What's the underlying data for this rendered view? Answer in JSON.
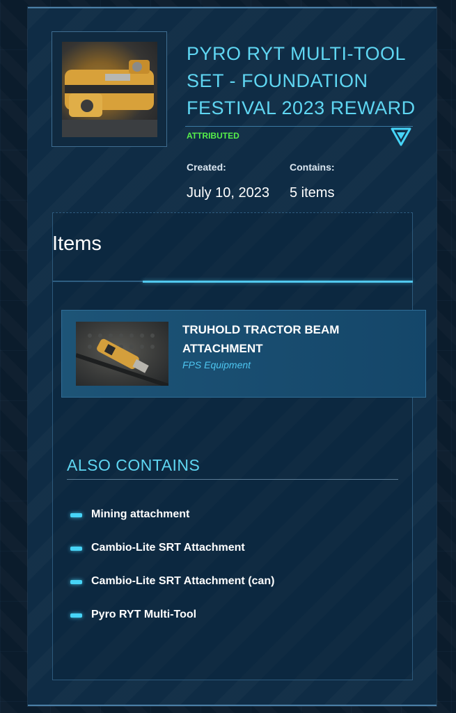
{
  "bundle": {
    "title": "PYRO RYT MULTI-TOOL SET - FOUNDATION FESTIVAL 2023 REWARD",
    "status": "ATTRIBUTED",
    "expand_icon": "triangle-down-icon",
    "thumbnail_icon": "multi-tool-image",
    "created_label": "Created:",
    "created_value": "July 10, 2023",
    "contains_label": "Contains:",
    "contains_value": "5 items"
  },
  "items_section": {
    "heading": "Items",
    "items": [
      {
        "name": "TRUHOLD TRACTOR BEAM ATTACHMENT",
        "type": "FPS Equipment",
        "image_icon": "tractor-beam-attachment-image"
      }
    ]
  },
  "also_contains": {
    "heading": "ALSO CONTAINS",
    "bullet_icon": "bullet-dash-icon",
    "items": [
      "Mining attachment",
      "Cambio-Lite SRT Attachment",
      "Cambio-Lite SRT Attachment (can)",
      "Pyro RYT Multi-Tool"
    ]
  },
  "colors": {
    "background": "#0b1c2c",
    "panel": "#0f2c45",
    "accent_cyan": "#5fd6f2",
    "status_green": "#56f04a",
    "card": "#174a6d",
    "bullet": "#47d4f7"
  }
}
